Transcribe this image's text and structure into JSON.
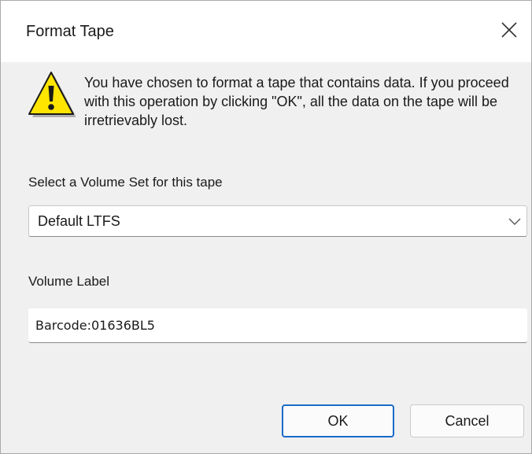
{
  "window": {
    "title": "Format Tape",
    "close_icon": "close-icon"
  },
  "warning": {
    "icon": "warning-icon",
    "message": "You have chosen to format a tape that contains data.  If you proceed with this operation by clicking \"OK\", all the data on the tape will be irretrievably lost."
  },
  "volume_set": {
    "label": "Select a Volume Set for this tape",
    "selected": "Default LTFS",
    "icon": "chevron-down-icon"
  },
  "volume_label": {
    "label": "Volume Label",
    "value": "Barcode:01636BL5"
  },
  "buttons": {
    "ok": "OK",
    "cancel": "Cancel"
  },
  "colors": {
    "dialog_background": "#f0f0f0",
    "title_background": "#ffffff",
    "warning_fill": "#ffe500",
    "default_button_border": "#1b6ac9"
  }
}
